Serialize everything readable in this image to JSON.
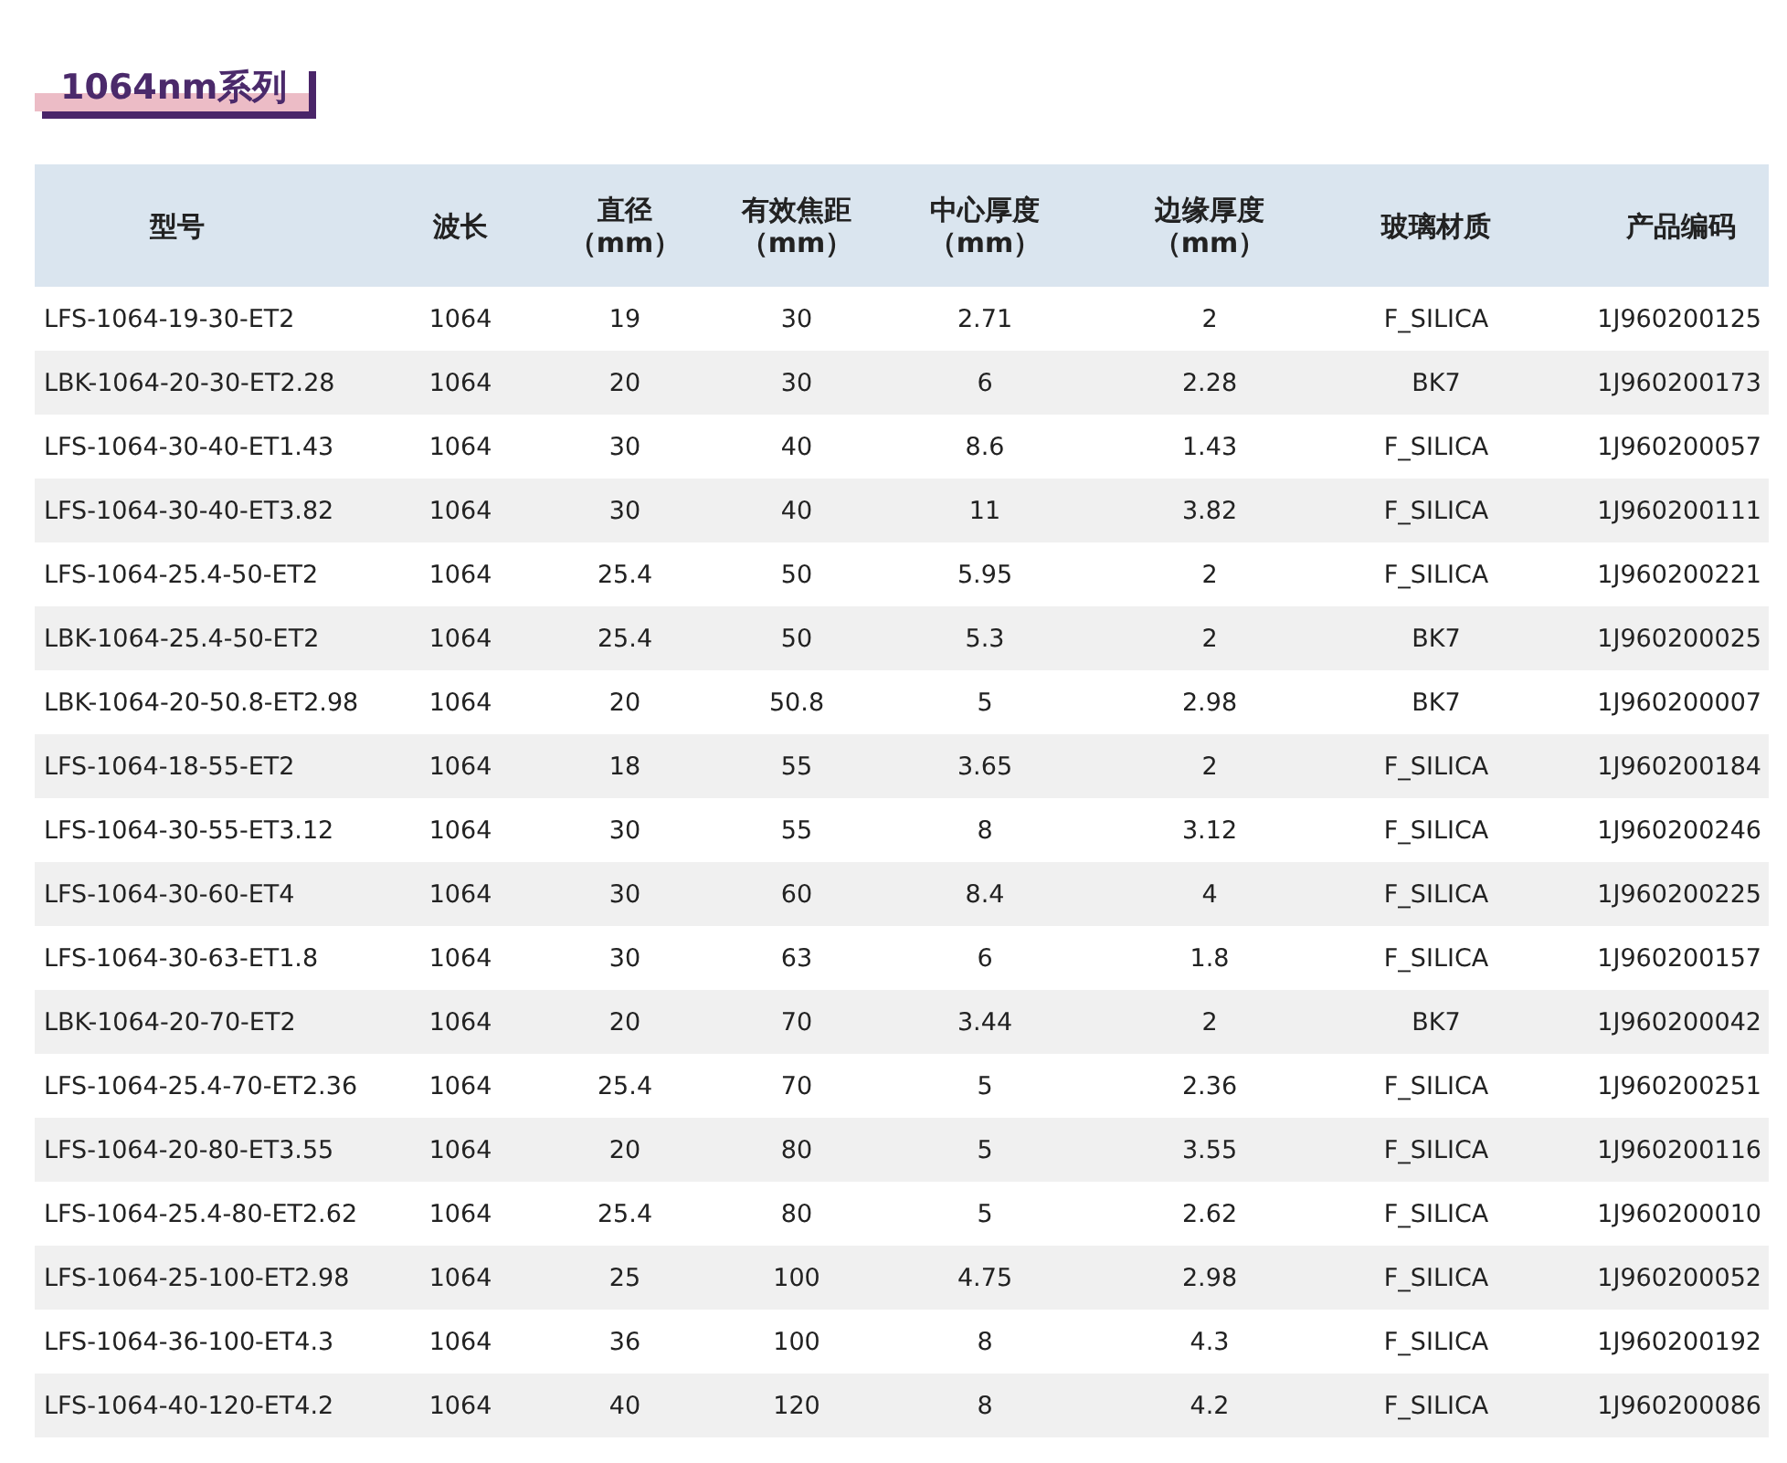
{
  "title": "1064nm系列",
  "table": {
    "columns": [
      "型号",
      "波长",
      "直径（mm）",
      "有效焦距（mm）",
      "中心厚度（mm）",
      "边缘厚度（mm）",
      "玻璃材质",
      "产品编码"
    ],
    "rows": [
      [
        "LFS-1064-19-30-ET2",
        "1064",
        "19",
        "30",
        "2.71",
        "2",
        "F_SILICA",
        "1J960200125"
      ],
      [
        "LBK-1064-20-30-ET2.28",
        "1064",
        "20",
        "30",
        "6",
        "2.28",
        "BK7",
        "1J960200173"
      ],
      [
        "LFS-1064-30-40-ET1.43",
        "1064",
        "30",
        "40",
        "8.6",
        "1.43",
        "F_SILICA",
        "1J960200057"
      ],
      [
        "LFS-1064-30-40-ET3.82",
        "1064",
        "30",
        "40",
        "11",
        "3.82",
        "F_SILICA",
        "1J960200111"
      ],
      [
        "LFS-1064-25.4-50-ET2",
        "1064",
        "25.4",
        "50",
        "5.95",
        "2",
        "F_SILICA",
        "1J960200221"
      ],
      [
        "LBK-1064-25.4-50-ET2",
        "1064",
        "25.4",
        "50",
        "5.3",
        "2",
        "BK7",
        "1J960200025"
      ],
      [
        "LBK-1064-20-50.8-ET2.98",
        "1064",
        "20",
        "50.8",
        "5",
        "2.98",
        "BK7",
        "1J960200007"
      ],
      [
        "LFS-1064-18-55-ET2",
        "1064",
        "18",
        "55",
        "3.65",
        "2",
        "F_SILICA",
        "1J960200184"
      ],
      [
        "LFS-1064-30-55-ET3.12",
        "1064",
        "30",
        "55",
        "8",
        "3.12",
        "F_SILICA",
        "1J960200246"
      ],
      [
        "LFS-1064-30-60-ET4",
        "1064",
        "30",
        "60",
        "8.4",
        "4",
        "F_SILICA",
        "1J960200225"
      ],
      [
        "LFS-1064-30-63-ET1.8",
        "1064",
        "30",
        "63",
        "6",
        "1.8",
        "F_SILICA",
        "1J960200157"
      ],
      [
        "LBK-1064-20-70-ET2",
        "1064",
        "20",
        "70",
        "3.44",
        "2",
        "BK7",
        "1J960200042"
      ],
      [
        "LFS-1064-25.4-70-ET2.36",
        "1064",
        "25.4",
        "70",
        "5",
        "2.36",
        "F_SILICA",
        "1J960200251"
      ],
      [
        "LFS-1064-20-80-ET3.55",
        "1064",
        "20",
        "80",
        "5",
        "3.55",
        "F_SILICA",
        "1J960200116"
      ],
      [
        "LFS-1064-25.4-80-ET2.62",
        "1064",
        "25.4",
        "80",
        "5",
        "2.62",
        "F_SILICA",
        "1J960200010"
      ],
      [
        "LFS-1064-25-100-ET2.98",
        "1064",
        "25",
        "100",
        "4.75",
        "2.98",
        "F_SILICA",
        "1J960200052"
      ],
      [
        "LFS-1064-36-100-ET4.3",
        "1064",
        "36",
        "100",
        "8",
        "4.3",
        "F_SILICA",
        "1J960200192"
      ],
      [
        "LFS-1064-40-120-ET4.2",
        "1064",
        "40",
        "120",
        "8",
        "4.2",
        "F_SILICA",
        "1J960200086"
      ]
    ]
  }
}
